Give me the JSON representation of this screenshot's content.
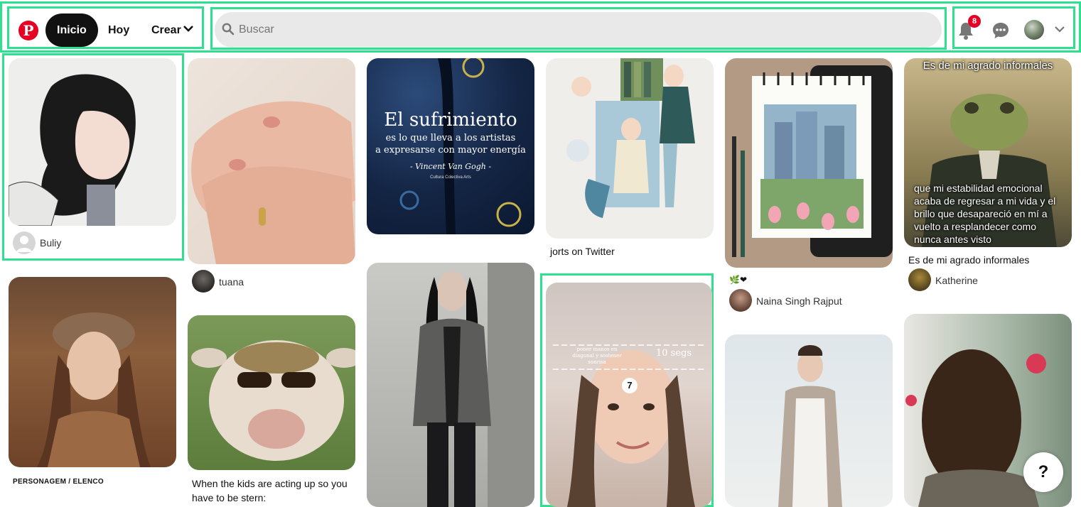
{
  "header": {
    "logo_letter": "P",
    "nav": {
      "home": "Inicio",
      "today": "Hoy",
      "create": "Crear"
    },
    "search": {
      "placeholder": "Buscar",
      "value": ""
    },
    "notifications_count": "8"
  },
  "pins": {
    "p1": {
      "user": "Buliy"
    },
    "p2": {
      "user": "tuana"
    },
    "p3": {
      "title_line1": "El sufrimiento",
      "title_line2": "es lo que lleva a los artistas",
      "title_line3": "a expresarse con mayor energía",
      "author": "- Vincent Van Gogh -",
      "credit": "Cultura Colectiva Arts"
    },
    "p4": {
      "caption": "jorts on Twitter"
    },
    "p5": {
      "emoji_caption": "🌿❤",
      "user": "Naina Singh Rajput"
    },
    "p6": {
      "top_text": "Es de mi agrado informales",
      "bottom_text": "que mi estabilidad emocional acaba de regresar a mi vida y el brillo que desapareció en mí a vuelto a resplandecer como nunca antes visto",
      "caption": "Es de mi agrado informales",
      "user": "Katherine"
    },
    "p7": {
      "caption": "PERSONAGEM / ELENCO"
    },
    "p8": {
      "caption": "When the kids are acting up so you have to be stern:"
    },
    "p10": {
      "overlay_left": "poner manos en diagonal y sostener sonrisa",
      "overlay_right": "10 segs",
      "counter": "7"
    }
  },
  "help_label": "?"
}
